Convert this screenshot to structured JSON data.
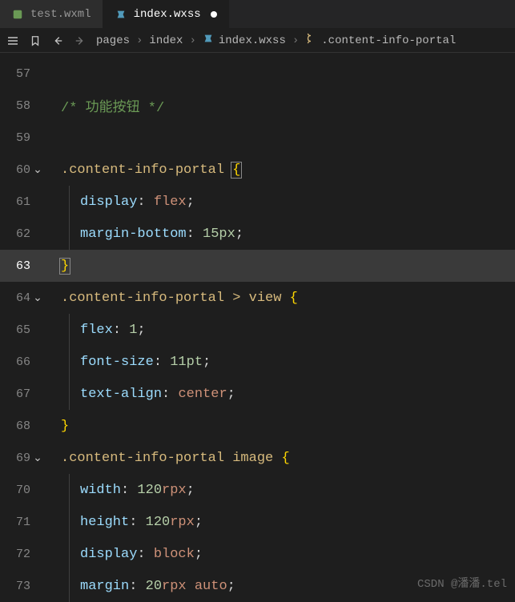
{
  "tabs": [
    {
      "icon": "file-wxml-icon",
      "label": "test.wxml",
      "modified": false,
      "active": false
    },
    {
      "icon": "file-wxss-icon",
      "label": "index.wxss",
      "modified": true,
      "active": true
    }
  ],
  "breadcrumbs": {
    "items": [
      {
        "icon": null,
        "label": "pages"
      },
      {
        "icon": null,
        "label": "index"
      },
      {
        "icon": "file-wxss-icon",
        "label": "index.wxss"
      },
      {
        "icon": "class-icon",
        "label": ".content-info-portal"
      }
    ]
  },
  "editor": {
    "current_line": 63,
    "lines": [
      {
        "n": 57,
        "chev": false,
        "indent": 0,
        "tokens": []
      },
      {
        "n": 58,
        "chev": false,
        "indent": 0,
        "tokens": [
          {
            "t": "comment",
            "v": "/* 功能按钮 */"
          }
        ]
      },
      {
        "n": 59,
        "chev": false,
        "indent": 0,
        "tokens": []
      },
      {
        "n": 60,
        "chev": true,
        "indent": 0,
        "tokens": [
          {
            "t": "selector",
            "v": ".content-info-portal"
          },
          {
            "t": "plain",
            "v": " "
          },
          {
            "t": "brace-hl",
            "v": "{"
          }
        ]
      },
      {
        "n": 61,
        "chev": false,
        "indent": 1,
        "tokens": [
          {
            "t": "prop",
            "v": "display"
          },
          {
            "t": "colon",
            "v": ": "
          },
          {
            "t": "value",
            "v": "flex"
          },
          {
            "t": "semi",
            "v": ";"
          }
        ]
      },
      {
        "n": 62,
        "chev": false,
        "indent": 1,
        "tokens": [
          {
            "t": "prop",
            "v": "margin-bottom"
          },
          {
            "t": "colon",
            "v": ": "
          },
          {
            "t": "number",
            "v": "15px"
          },
          {
            "t": "semi",
            "v": ";"
          }
        ]
      },
      {
        "n": 63,
        "chev": false,
        "indent": 0,
        "current": true,
        "tokens": [
          {
            "t": "brace-hl",
            "v": "}"
          }
        ]
      },
      {
        "n": 64,
        "chev": true,
        "indent": 0,
        "tokens": [
          {
            "t": "selector",
            "v": ".content-info-portal > view"
          },
          {
            "t": "plain",
            "v": " "
          },
          {
            "t": "brace",
            "v": "{"
          }
        ]
      },
      {
        "n": 65,
        "chev": false,
        "indent": 1,
        "tokens": [
          {
            "t": "prop",
            "v": "flex"
          },
          {
            "t": "colon",
            "v": ": "
          },
          {
            "t": "number",
            "v": "1"
          },
          {
            "t": "semi",
            "v": ";"
          }
        ]
      },
      {
        "n": 66,
        "chev": false,
        "indent": 1,
        "tokens": [
          {
            "t": "prop",
            "v": "font-size"
          },
          {
            "t": "colon",
            "v": ": "
          },
          {
            "t": "number",
            "v": "11pt"
          },
          {
            "t": "semi",
            "v": ";"
          }
        ]
      },
      {
        "n": 67,
        "chev": false,
        "indent": 1,
        "tokens": [
          {
            "t": "prop",
            "v": "text-align"
          },
          {
            "t": "colon",
            "v": ": "
          },
          {
            "t": "value",
            "v": "center"
          },
          {
            "t": "semi",
            "v": ";"
          }
        ]
      },
      {
        "n": 68,
        "chev": false,
        "indent": 0,
        "tokens": [
          {
            "t": "brace",
            "v": "}"
          }
        ]
      },
      {
        "n": 69,
        "chev": true,
        "indent": 0,
        "tokens": [
          {
            "t": "selector",
            "v": ".content-info-portal image"
          },
          {
            "t": "plain",
            "v": " "
          },
          {
            "t": "brace",
            "v": "{"
          }
        ]
      },
      {
        "n": 70,
        "chev": false,
        "indent": 1,
        "tokens": [
          {
            "t": "prop",
            "v": "width"
          },
          {
            "t": "colon",
            "v": ": "
          },
          {
            "t": "number",
            "v": "120"
          },
          {
            "t": "value",
            "v": "rpx"
          },
          {
            "t": "semi",
            "v": ";"
          }
        ]
      },
      {
        "n": 71,
        "chev": false,
        "indent": 1,
        "tokens": [
          {
            "t": "prop",
            "v": "height"
          },
          {
            "t": "colon",
            "v": ": "
          },
          {
            "t": "number",
            "v": "120"
          },
          {
            "t": "value",
            "v": "rpx"
          },
          {
            "t": "semi",
            "v": ";"
          }
        ]
      },
      {
        "n": 72,
        "chev": false,
        "indent": 1,
        "tokens": [
          {
            "t": "prop",
            "v": "display"
          },
          {
            "t": "colon",
            "v": ": "
          },
          {
            "t": "value",
            "v": "block"
          },
          {
            "t": "semi",
            "v": ";"
          }
        ]
      },
      {
        "n": 73,
        "chev": false,
        "indent": 1,
        "tokens": [
          {
            "t": "prop",
            "v": "margin"
          },
          {
            "t": "colon",
            "v": ": "
          },
          {
            "t": "number",
            "v": "20"
          },
          {
            "t": "value",
            "v": "rpx "
          },
          {
            "t": "value",
            "v": "auto"
          },
          {
            "t": "semi",
            "v": ";"
          }
        ]
      }
    ]
  },
  "watermark": "CSDN @潘潘.tel"
}
